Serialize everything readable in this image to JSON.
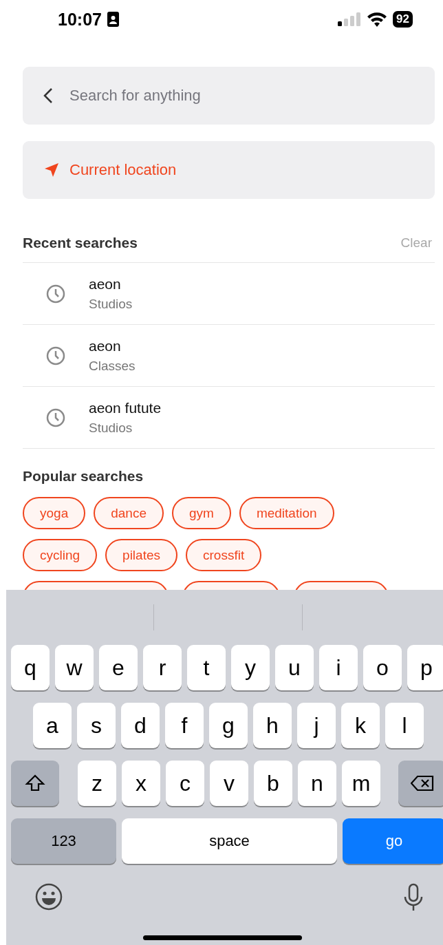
{
  "status_bar": {
    "time": "10:07",
    "battery": "92"
  },
  "search": {
    "placeholder": "Search for anything"
  },
  "location": {
    "label": "Current location"
  },
  "recent": {
    "title": "Recent searches",
    "clear": "Clear",
    "items": [
      {
        "query": "aeon",
        "category": "Studios"
      },
      {
        "query": "aeon",
        "category": "Classes"
      },
      {
        "query": "aeon futute",
        "category": "Studios"
      }
    ]
  },
  "popular": {
    "title": "Popular searches",
    "chips": [
      "yoga",
      "dance",
      "gym",
      "meditation",
      "cycling",
      "pilates",
      "crossfit"
    ]
  },
  "keyboard": {
    "rows": [
      [
        "q",
        "w",
        "e",
        "r",
        "t",
        "y",
        "u",
        "i",
        "o",
        "p"
      ],
      [
        "a",
        "s",
        "d",
        "f",
        "g",
        "h",
        "j",
        "k",
        "l"
      ],
      [
        "z",
        "x",
        "c",
        "v",
        "b",
        "n",
        "m"
      ]
    ],
    "numbers": "123",
    "space": "space",
    "go": "go"
  }
}
